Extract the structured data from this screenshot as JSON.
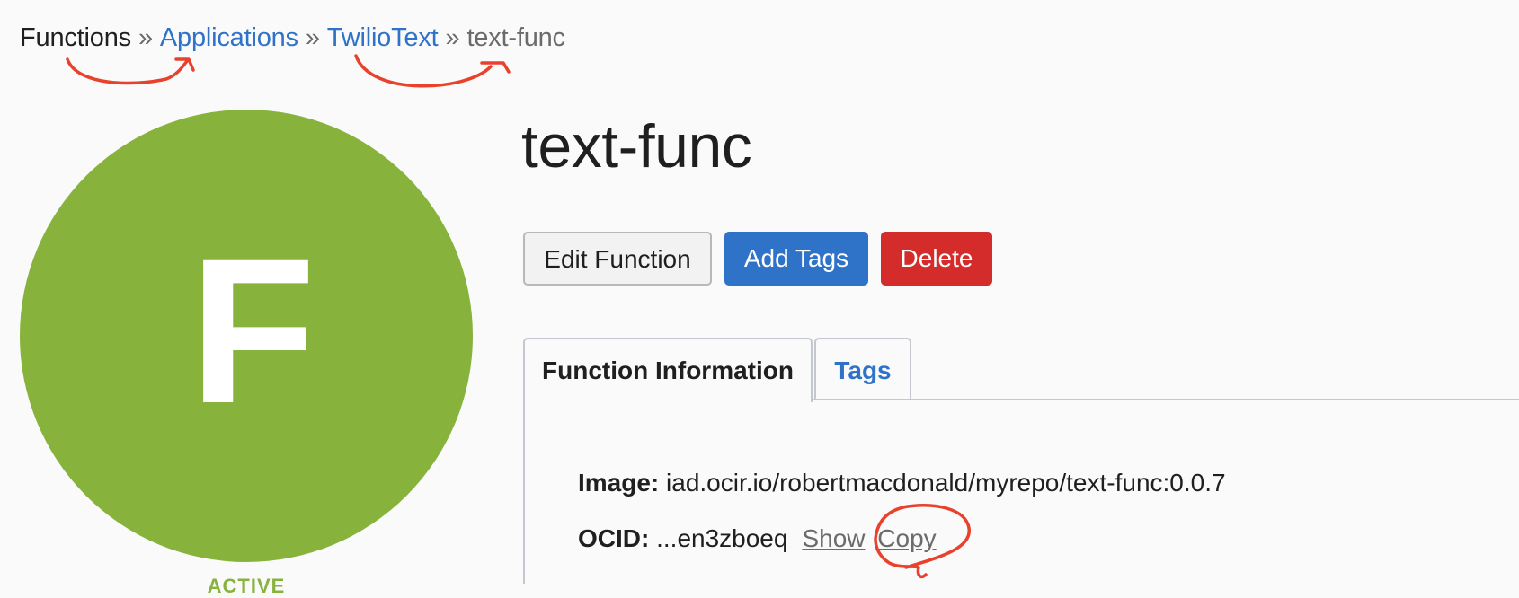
{
  "breadcrumb": {
    "root": "Functions",
    "sep": "»",
    "applications": "Applications",
    "app": "TwilioText",
    "current": "text-func"
  },
  "avatar": {
    "letter": "F",
    "status": "ACTIVE"
  },
  "page_title": "text-func",
  "actions": {
    "edit": "Edit Function",
    "add_tags": "Add Tags",
    "delete": "Delete"
  },
  "tabs": {
    "info": "Function Information",
    "tags": "Tags"
  },
  "details": {
    "image_label": "Image:",
    "image_value": "iad.ocir.io/robertmacdonald/myrepo/text-func:0.0.7",
    "ocid_label": "OCID:",
    "ocid_value": "...en3zboeq",
    "show": "Show",
    "copy": "Copy"
  },
  "colors": {
    "link": "#2f73c9",
    "avatar": "#87b33d",
    "delete": "#d42b2b",
    "annotation": "#e8412c"
  }
}
